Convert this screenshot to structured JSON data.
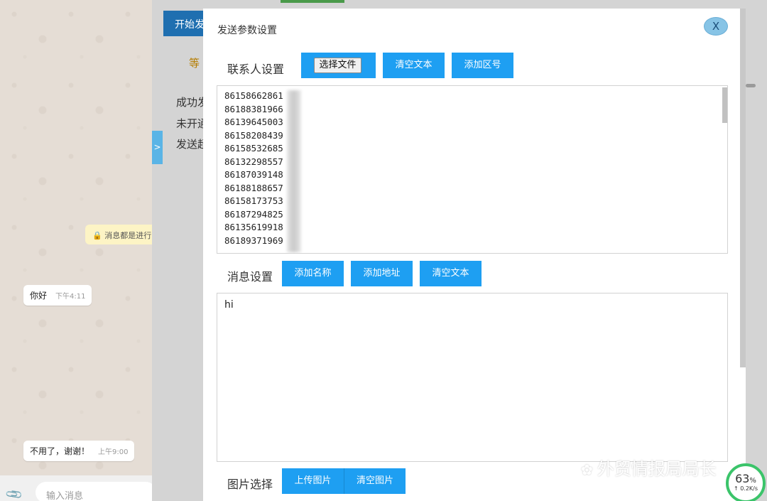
{
  "chat": {
    "notice": "消息都是进行",
    "messages": [
      {
        "text": "你好",
        "time": "下午4:11"
      },
      {
        "text": "不用了，谢谢！",
        "time": "上午9:00"
      }
    ],
    "input_placeholder": "输入消息"
  },
  "background": {
    "start_button": "开始发",
    "tab": "等",
    "lines": [
      "成功发",
      "未开通",
      "发送超"
    ],
    "toggle_arrow": ">"
  },
  "modal": {
    "title": "发送参数设置",
    "close_label": "X",
    "contact_section": {
      "label": "联系人设置",
      "choose_file": "选择文件",
      "clear_text": "清空文本",
      "add_area_code": "添加区号",
      "numbers": [
        "86158662861",
        "86188381966",
        "86139645003",
        "86158208439",
        "86158532685",
        "86132298557",
        "86187039148",
        "86188188657",
        "86158173753",
        "86187294825",
        "86135619918",
        "86189371969"
      ]
    },
    "message_section": {
      "label": "消息设置",
      "add_name": "添加名称",
      "add_address": "添加地址",
      "clear_text": "清空文本",
      "content": "hi"
    },
    "image_section": {
      "label": "图片选择",
      "upload": "上传图片",
      "clear": "清空图片"
    }
  },
  "watermark": {
    "text": "外贸情报局局长"
  },
  "speed_badge": {
    "percent": "63",
    "percent_sign": "%",
    "rate": "↑ 0.2K/s"
  }
}
